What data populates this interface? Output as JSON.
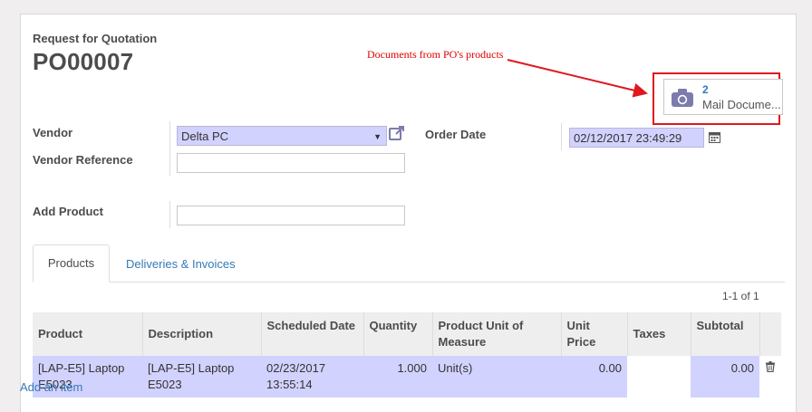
{
  "form": {
    "subtitle": "Request for Quotation",
    "title": "PO00007"
  },
  "annotation": {
    "text": "Documents from PO's products",
    "color": "#e00000"
  },
  "smart_button": {
    "count": "2",
    "label": "Mail Docume...",
    "icon": "camera-icon"
  },
  "fields": {
    "vendor_label": "Vendor",
    "vendor_value": "Delta PC",
    "vendor_reference_label": "Vendor Reference",
    "vendor_reference_value": "",
    "order_date_label": "Order Date",
    "order_date_value": "02/12/2017 23:49:29",
    "add_product_label": "Add Product",
    "add_product_value": ""
  },
  "tabs": [
    {
      "label": "Products",
      "active": true
    },
    {
      "label": "Deliveries & Invoices",
      "active": false
    }
  ],
  "pager": "1-1 of 1",
  "table": {
    "headers": [
      "Product",
      "Description",
      "Scheduled Date",
      "Quantity",
      "Product Unit of Measure",
      "Unit Price",
      "Taxes",
      "Subtotal"
    ],
    "rows": [
      {
        "product": "[LAP-E5] Laptop E5023",
        "description": "[LAP-E5] Laptop E5023",
        "scheduled_date": "02/23/2017 13:55:14",
        "quantity": "1.000",
        "uom": "Unit(s)",
        "unit_price": "0.00",
        "taxes": "",
        "subtotal": "0.00"
      }
    ]
  },
  "add_line": "Add an item",
  "colors": {
    "accent": "#337ab7",
    "selected_row": "#d2d2ff",
    "required_field": "#d2d2ff",
    "highlight_box": "#e0171e"
  }
}
